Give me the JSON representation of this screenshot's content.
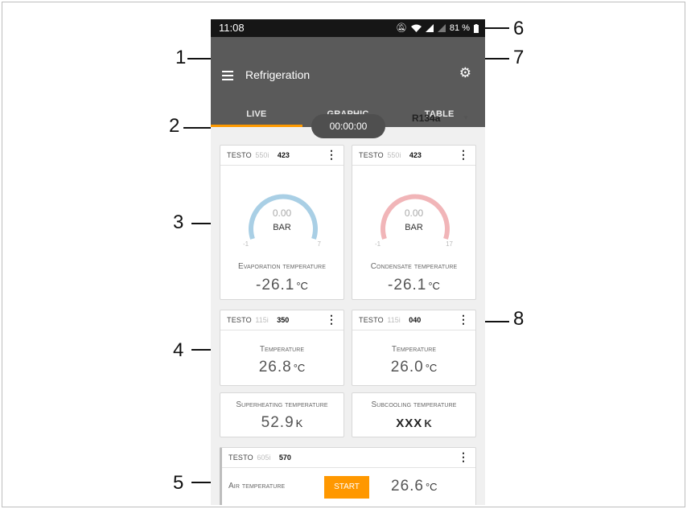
{
  "status": {
    "time": "11:08",
    "battery": "81 %"
  },
  "appbar": {
    "title": "Refrigeration"
  },
  "tabs": [
    {
      "label": "LIVE",
      "active": true
    },
    {
      "label": "GRAPHIC",
      "active": false
    },
    {
      "label": "TABLE",
      "active": false
    }
  ],
  "timer": "00:00:00",
  "refrigerant": "R134a",
  "gauges": [
    {
      "brand": "TESTO",
      "model": "550i",
      "serial": "423",
      "value": "0.00",
      "unit": "BAR",
      "min": "-1",
      "max": "7",
      "label": "Evaporation temperature",
      "reading": "-26.1",
      "reading_unit": "°C",
      "color": "#a9cfe5"
    },
    {
      "brand": "TESTO",
      "model": "550i",
      "serial": "423",
      "value": "0.00",
      "unit": "BAR",
      "min": "-1",
      "max": "17",
      "label": "Condensate temperature",
      "reading": "-26.1",
      "reading_unit": "°C",
      "color": "#f1b5b8"
    }
  ],
  "temps": [
    {
      "brand": "TESTO",
      "model": "115i",
      "serial": "350",
      "label": "Temperature",
      "reading": "26.8",
      "reading_unit": "°C"
    },
    {
      "brand": "TESTO",
      "model": "115i",
      "serial": "040",
      "label": "Temperature",
      "reading": "26.0",
      "reading_unit": "°C"
    }
  ],
  "derived": [
    {
      "label": "Superheating temperature",
      "reading": "52.9",
      "reading_unit": "K"
    },
    {
      "label": "Subcooling temperature",
      "reading": "XXX",
      "reading_unit": "K"
    }
  ],
  "air": {
    "brand": "TESTO",
    "model": "605i",
    "serial": "570",
    "label": "Air temperature",
    "button": "START",
    "reading": "26.6",
    "reading_unit": "°C"
  },
  "callouts": [
    "1",
    "2",
    "3",
    "4",
    "5",
    "6",
    "7",
    "8"
  ]
}
